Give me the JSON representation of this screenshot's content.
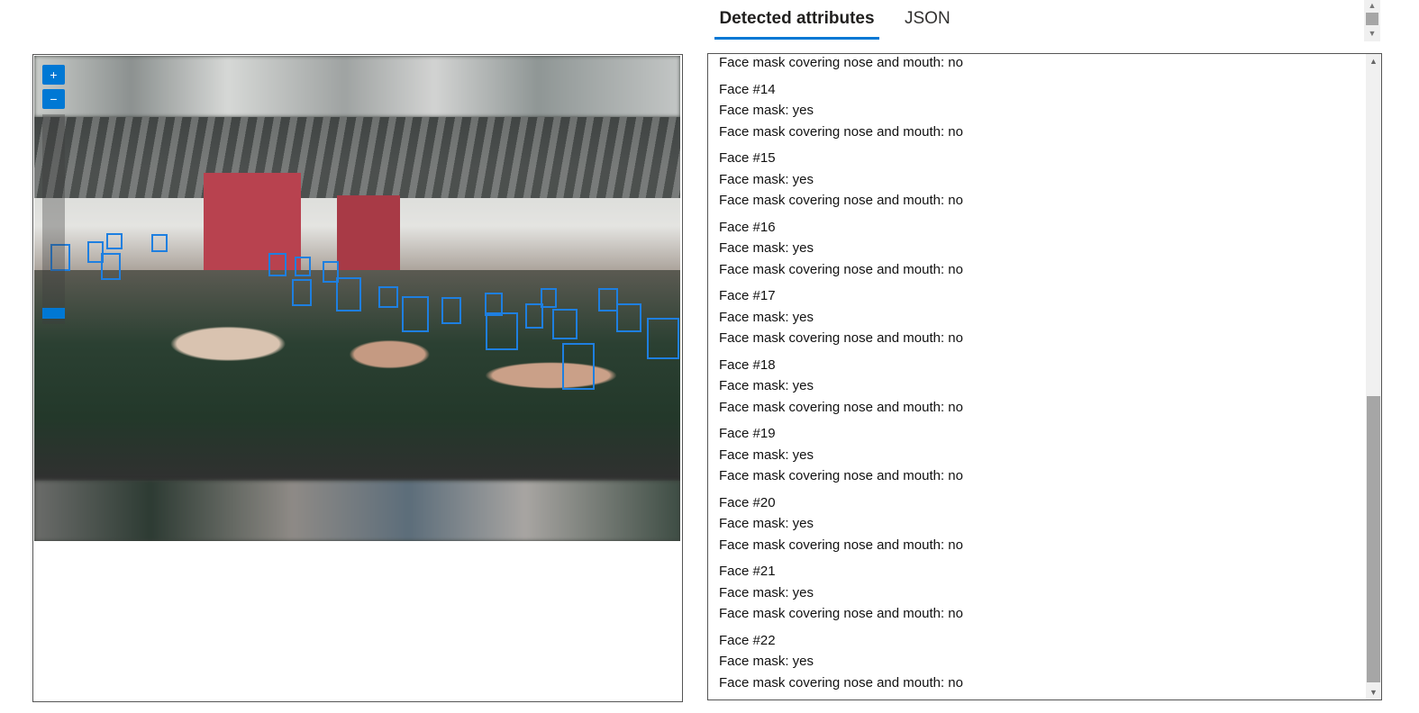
{
  "tabs": [
    {
      "label": "Detected attributes",
      "active": true
    },
    {
      "label": "JSON",
      "active": false
    }
  ],
  "zoom": {
    "in_label": "+",
    "out_label": "−"
  },
  "accent_color": "#0078d4",
  "attributes": {
    "first_line": "Face mask covering nose and mouth: no",
    "faces": [
      {
        "title": "Face #14",
        "mask": "Face mask: yes",
        "covering": "Face mask covering nose and mouth: no"
      },
      {
        "title": "Face #15",
        "mask": "Face mask: yes",
        "covering": "Face mask covering nose and mouth: no"
      },
      {
        "title": "Face #16",
        "mask": "Face mask: yes",
        "covering": "Face mask covering nose and mouth: no"
      },
      {
        "title": "Face #17",
        "mask": "Face mask: yes",
        "covering": "Face mask covering nose and mouth: no"
      },
      {
        "title": "Face #18",
        "mask": "Face mask: yes",
        "covering": "Face mask covering nose and mouth: no"
      },
      {
        "title": "Face #19",
        "mask": "Face mask: yes",
        "covering": "Face mask covering nose and mouth: no"
      },
      {
        "title": "Face #20",
        "mask": "Face mask: yes",
        "covering": "Face mask covering nose and mouth: no"
      },
      {
        "title": "Face #21",
        "mask": "Face mask: yes",
        "covering": "Face mask covering nose and mouth: no"
      },
      {
        "title": "Face #22",
        "mask": "Face mask: yes",
        "covering": "Face mask covering nose and mouth: no"
      }
    ]
  }
}
